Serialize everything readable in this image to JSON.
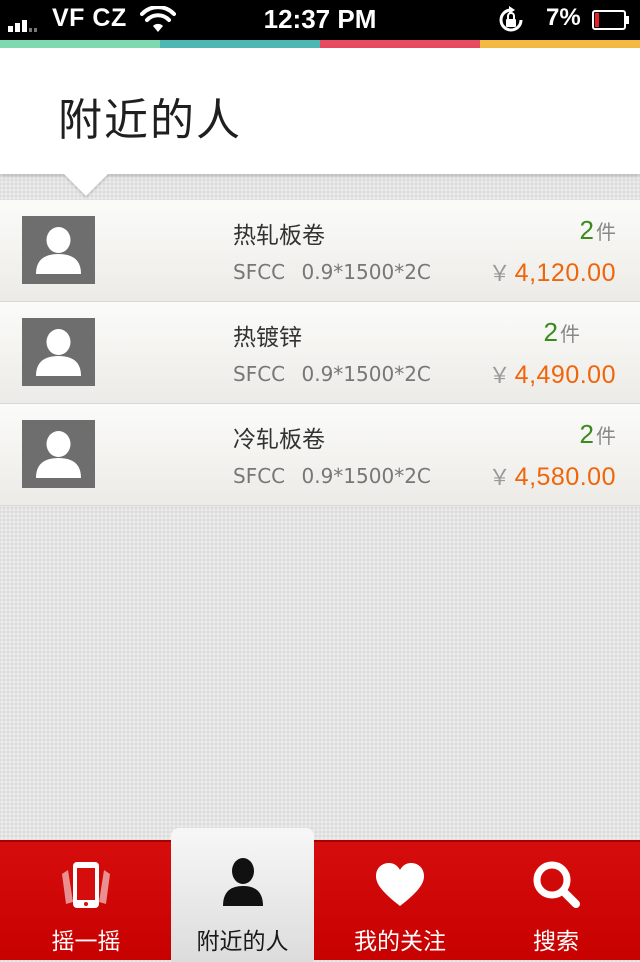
{
  "status_bar": {
    "carrier": "VF CZ",
    "time": "12:37 PM",
    "battery": "7%"
  },
  "stripe_colors": [
    "#7fd9b0",
    "#4db8b3",
    "#e84a5f",
    "#f4b942"
  ],
  "header": {
    "title": "附近的人"
  },
  "items": [
    {
      "name": "热轧板卷",
      "brand": "SFCC",
      "spec": "0.9*1500*2C",
      "qty": "2",
      "unit": "件",
      "currency": "￥",
      "price": "4,120.00"
    },
    {
      "name": "热镀锌",
      "brand": "SFCC",
      "spec": "0.9*1500*2C",
      "qty": "2",
      "unit": "件",
      "currency": "￥",
      "price": "4,490.00"
    },
    {
      "name": "冷轧板卷",
      "brand": "SFCC",
      "spec": "0.9*1500*2C",
      "qty": "2",
      "unit": "件",
      "currency": "￥",
      "price": "4,580.00"
    }
  ],
  "tabs": [
    {
      "label": "摇一摇",
      "icon": "phone-shake-icon",
      "active": false
    },
    {
      "label": "附近的人",
      "icon": "person-icon",
      "active": true
    },
    {
      "label": "我的关注",
      "icon": "heart-icon",
      "active": false
    },
    {
      "label": "搜索",
      "icon": "search-icon",
      "active": false
    }
  ],
  "colors": {
    "tabbar": "#c70000",
    "price": "#f0650a",
    "quantity": "#3a8a1e"
  }
}
